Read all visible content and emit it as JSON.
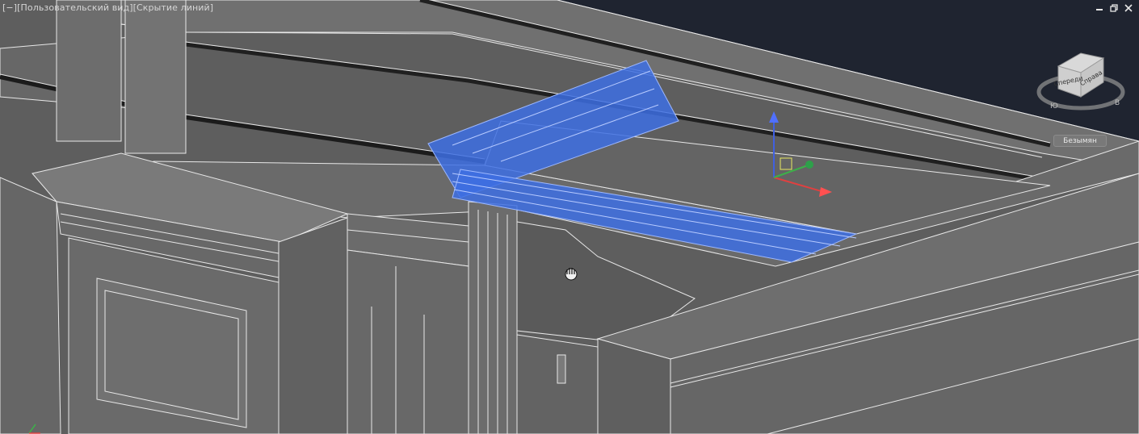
{
  "viewport": {
    "control_label": "[−]",
    "view_label": "[Пользовательский вид]",
    "visual_style_label": "[Скрытие линий]"
  },
  "window_controls": {
    "minimize_icon": "minimize-icon",
    "restore_icon": "restore-icon",
    "close_icon": "close-icon"
  },
  "viewcube": {
    "front_label": "Спереди",
    "right_label": "Справа",
    "compass_south": "Ю",
    "compass_east": "В"
  },
  "ucs_dropdown": {
    "label": "Безымян"
  },
  "colors": {
    "background": "#1f2430",
    "selection_blue": "#3d6fe3",
    "wireframe_edge": "#ececec",
    "axis_x": "#e04040",
    "axis_y": "#3db04a",
    "axis_z": "#4060e0"
  },
  "cursor": {
    "icon": "pan-hand-icon"
  }
}
